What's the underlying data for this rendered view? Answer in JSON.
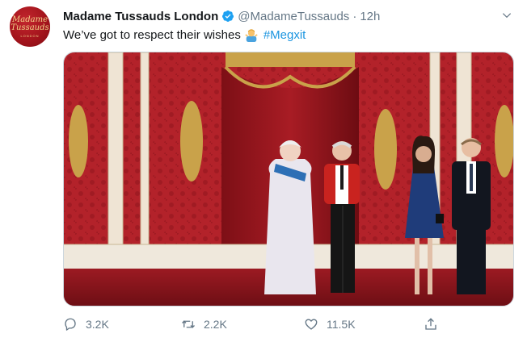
{
  "avatar": {
    "line1": "Madame",
    "line2": "Tussauds",
    "line3": "LONDON"
  },
  "tweet": {
    "author_name": "Madame Tussauds London",
    "handle": "@MadameTussauds",
    "separator": "·",
    "time": "12h",
    "text": "We’ve got to respect their wishes",
    "hashtag": "#Megxit"
  },
  "actions": {
    "reply_count": "3.2K",
    "retweet_count": "2.2K",
    "like_count": "11.5K"
  },
  "icons": {
    "verified": "verified-badge-icon",
    "menu": "chevron-down-icon",
    "emoji": "person-shrugging-emoji",
    "reply": "reply-icon",
    "retweet": "retweet-icon",
    "like": "heart-icon",
    "share": "share-icon"
  },
  "colors": {
    "link": "#1b95e0",
    "muted": "#657786",
    "verified": "#1da1f2",
    "brand_red": "#a1131b"
  }
}
